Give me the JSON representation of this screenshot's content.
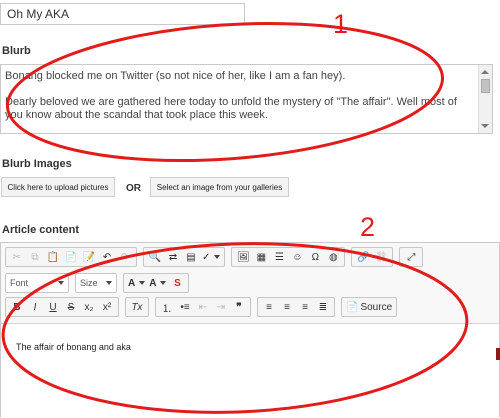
{
  "title_field": {
    "value": "Oh My AKA"
  },
  "blurb": {
    "label": "Blurb",
    "paragraphs": [
      "Bonang blocked me on Twitter (so not nice of her, like I am a fan hey).",
      "Dearly beloved we are gathered here today to unfold the mystery of \"The affair\". Well most of you know about the scandal that took place this week."
    ]
  },
  "blurb_images": {
    "label": "Blurb Images",
    "upload_button": "Click here to upload pictures",
    "or_text": "OR",
    "gallery_button": "Select an image from your galleries"
  },
  "article": {
    "label": "Article content",
    "font_combo": "Font",
    "size_combo": "Size",
    "source_button": "Source",
    "body_text": "The affair of bonang and aka"
  },
  "annotations": {
    "first": "1",
    "second": "2",
    "color": "#e21b1b"
  },
  "colors": {
    "annotation_red": "#e21b1b",
    "border": "#c9c9c9"
  }
}
